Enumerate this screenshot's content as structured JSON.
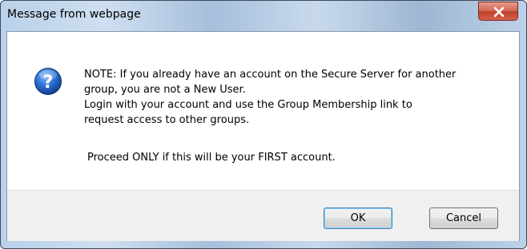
{
  "window": {
    "title": "Message from webpage"
  },
  "dialog": {
    "icon": "question-icon",
    "message_lines": [
      "NOTE: If you already have an account on the Secure Server for another",
      "group, you are not a New User.",
      " Login with your account and use the Group Membership link to",
      "request access to other groups."
    ],
    "proceed_text": "Proceed ONLY if this will be your FIRST account."
  },
  "buttons": {
    "ok_label": "OK",
    "cancel_label": "Cancel"
  },
  "colors": {
    "title_bar": "#b9d1ea",
    "close_button": "#c9503a",
    "icon_blue": "#1e5fbf",
    "footer": "#f0f0f0"
  }
}
